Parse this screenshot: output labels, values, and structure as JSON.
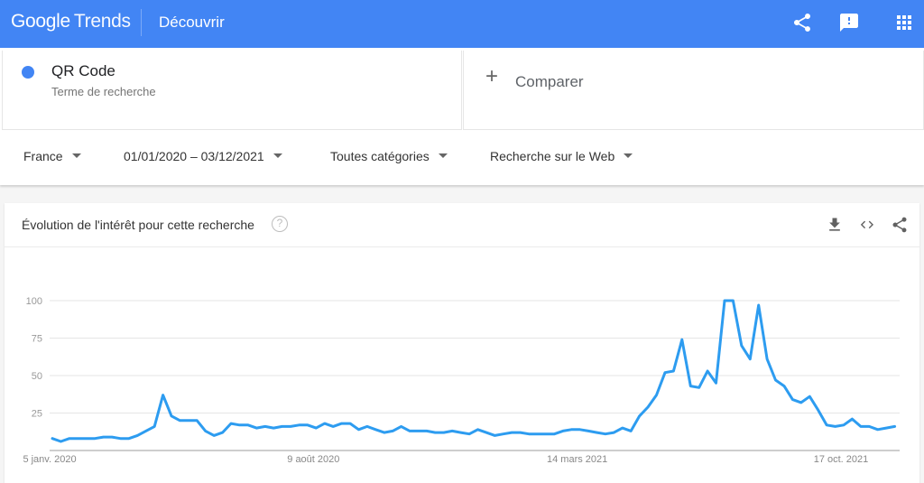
{
  "header": {
    "logo_google": "Google",
    "logo_trends": "Trends",
    "page_name": "Découvrir",
    "icons": [
      "share-icon",
      "feedback-icon",
      "apps-grid-icon"
    ]
  },
  "search": {
    "term": "QR Code",
    "term_type": "Terme de recherche",
    "term_color": "#4285f4",
    "compare_label": "Comparer"
  },
  "filters": {
    "region": "France",
    "date_range": "01/01/2020 – 03/12/2021",
    "category": "Toutes catégories",
    "search_type": "Recherche sur le Web"
  },
  "card": {
    "title": "Évolution de l'intérêt pour cette recherche",
    "help": "?",
    "icons": [
      "download-icon",
      "embed-code-icon",
      "share-icon"
    ]
  },
  "chart_data": {
    "type": "line",
    "title": "Évolution de l'intérêt pour cette recherche",
    "xlabel": "",
    "ylabel": "",
    "ylim": [
      0,
      100
    ],
    "yticks": [
      25,
      50,
      75,
      100
    ],
    "xtick_labels": [
      {
        "label": "5 janv. 2020",
        "index": 0
      },
      {
        "label": "9 août 2020",
        "index": 31
      },
      {
        "label": "14 mars 2021",
        "index": 62
      },
      {
        "label": "17 oct. 2021",
        "index": 93
      }
    ],
    "grid": true,
    "x_start": "5 janv. 2020",
    "x_interval": "week",
    "series": [
      {
        "name": "QR Code",
        "color": "#2d9cf0",
        "values": [
          8,
          6,
          8,
          8,
          8,
          8,
          9,
          9,
          8,
          8,
          10,
          13,
          16,
          37,
          23,
          20,
          20,
          20,
          13,
          10,
          12,
          18,
          17,
          17,
          15,
          16,
          15,
          16,
          16,
          17,
          17,
          15,
          18,
          16,
          18,
          18,
          14,
          16,
          14,
          12,
          13,
          16,
          13,
          13,
          13,
          12,
          12,
          13,
          12,
          11,
          14,
          12,
          10,
          11,
          12,
          12,
          11,
          11,
          11,
          11,
          13,
          14,
          14,
          13,
          12,
          11,
          12,
          15,
          13,
          23,
          29,
          37,
          52,
          53,
          74,
          43,
          42,
          53,
          45,
          100,
          100,
          70,
          61,
          97,
          61,
          47,
          43,
          34,
          32,
          36,
          27,
          17,
          16,
          17,
          21,
          16,
          16,
          14,
          15,
          16
        ]
      }
    ]
  }
}
